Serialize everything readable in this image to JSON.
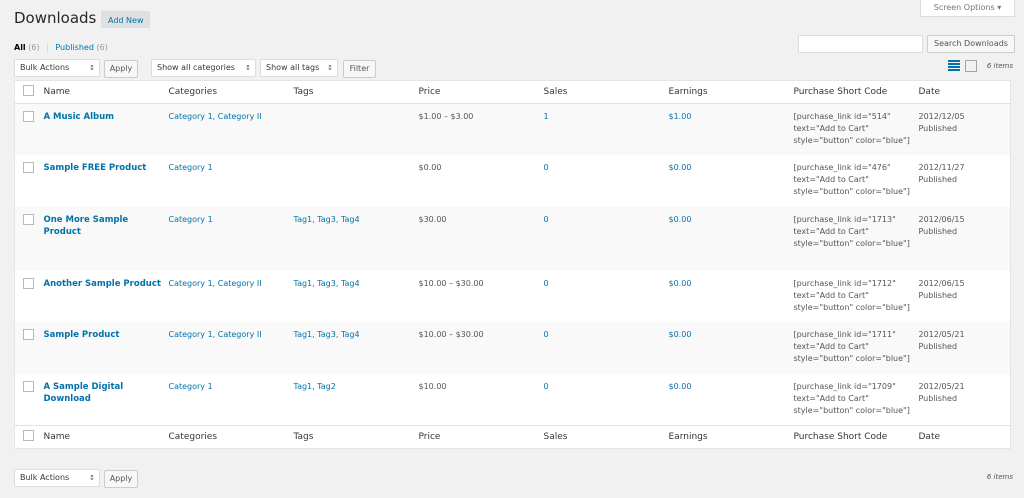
{
  "header": {
    "title": "Downloads",
    "add_new": "Add New",
    "screen_options": "Screen Options ▾"
  },
  "views": {
    "all_label": "All",
    "all_count": "(6)",
    "separator": "|",
    "published_label": "Published",
    "published_count": "(6)"
  },
  "search": {
    "button": "Search Downloads",
    "value": ""
  },
  "filters": {
    "bulk_actions": "Bulk Actions",
    "apply": "Apply",
    "categories": "Show all categories",
    "tags": "Show all tags",
    "filter": "Filter"
  },
  "items_count": "6 items",
  "columns": [
    "Name",
    "Categories",
    "Tags",
    "Price",
    "Sales",
    "Earnings",
    "Purchase Short Code",
    "Date"
  ],
  "rows": [
    {
      "name": "A Music Album",
      "categories": "Category 1, Category II",
      "tags": "",
      "price": "$1.00 – $3.00",
      "sales": "1",
      "earnings": "$1.00",
      "code1": "[purchase_link id=\"514\"",
      "code2": "text=\"Add to Cart\"",
      "code3": "style=\"button\" color=\"blue\"]",
      "date": "2012/12/05",
      "status": "Published"
    },
    {
      "name": "Sample FREE Product",
      "categories": "Category 1",
      "tags": "",
      "price": "$0.00",
      "sales": "0",
      "earnings": "$0.00",
      "code1": "[purchase_link id=\"476\"",
      "code2": "text=\"Add to Cart\"",
      "code3": "style=\"button\" color=\"blue\"]",
      "date": "2012/11/27",
      "status": "Published"
    },
    {
      "name_line1": "One More Sample",
      "name_line2": "Product",
      "categories": "Category 1",
      "tags": "Tag1, Tag3, Tag4",
      "price": "$30.00",
      "sales": "0",
      "earnings": "$0.00",
      "code1": "[purchase_link id=\"1713\"",
      "code2": "text=\"Add to Cart\"",
      "code3": "style=\"button\" color=\"blue\"]",
      "date": "2012/06/15",
      "status": "Published"
    },
    {
      "name": "Another Sample Product",
      "categories": "Category 1, Category II",
      "tags": "Tag1, Tag3, Tag4",
      "price": "$10.00 – $30.00",
      "sales": "0",
      "earnings": "$0.00",
      "code1": "[purchase_link id=\"1712\"",
      "code2": "text=\"Add to Cart\"",
      "code3": "style=\"button\" color=\"blue\"]",
      "date": "2012/06/15",
      "status": "Published"
    },
    {
      "name": "Sample Product",
      "categories": "Category 1, Category II",
      "tags": "Tag1, Tag3, Tag4",
      "price": "$10.00 – $30.00",
      "sales": "0",
      "earnings": "$0.00",
      "code1": "[purchase_link id=\"1711\"",
      "code2": "text=\"Add to Cart\"",
      "code3": "style=\"button\" color=\"blue\"]",
      "date": "2012/05/21",
      "status": "Published"
    },
    {
      "name_line1": "A Sample Digital",
      "name_line2": "Download",
      "categories": "Category 1",
      "tags": "Tag1, Tag2",
      "price": "$10.00",
      "sales": "0",
      "earnings": "$0.00",
      "code1": "[purchase_link id=\"1709\"",
      "code2": "text=\"Add to Cart\"",
      "code3": "style=\"button\" color=\"blue\"]",
      "date": "2012/05/21",
      "status": "Published"
    }
  ]
}
